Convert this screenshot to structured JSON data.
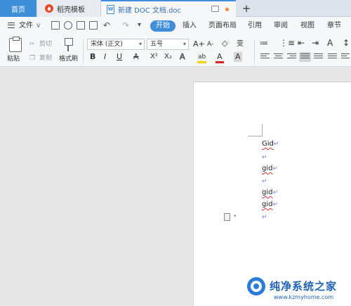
{
  "tabs": {
    "home": "首页",
    "template": "稻壳模板",
    "doc_icon": "W",
    "doc": "新建 DOC 文档.doc",
    "add": "+"
  },
  "menu": {
    "file": "文件",
    "chevron": "∨",
    "undo": "↶",
    "redo": "↷",
    "more": "▾",
    "items": [
      "开始",
      "插入",
      "页面布局",
      "引用",
      "审阅",
      "视图",
      "章节"
    ]
  },
  "ribbon": {
    "paste": "粘贴",
    "cut": "剪切",
    "copy": "复制",
    "format_painter": "格式刷",
    "font_name": "宋体 (正文)",
    "font_size": "五号",
    "dropdown": "▾",
    "grow": "A+",
    "shrink": "A-",
    "eraser": "◇",
    "phonetic": "变",
    "bold": "B",
    "italic": "I",
    "underline": "U",
    "strike": "A",
    "superscript": "X²",
    "subscript": "X₂",
    "text_effect": "A",
    "highlight": "ab",
    "font_color": "A",
    "char_shade": "A",
    "numbering": "≔",
    "bullets": "⋮≡",
    "indent_less": "⇤",
    "indent_more": "⇥",
    "case": "A",
    "sort": "↕"
  },
  "document": {
    "lines": [
      "Gid",
      "",
      "gid",
      "",
      "gid",
      "gid",
      ""
    ],
    "para_mark": "↵"
  },
  "watermark": {
    "title": "纯净系统之家",
    "url": "www.kzmyhome.com"
  },
  "colors": {
    "accent": "#3e8ed8",
    "highlight": "#f5d300",
    "font_color": "#d22"
  }
}
